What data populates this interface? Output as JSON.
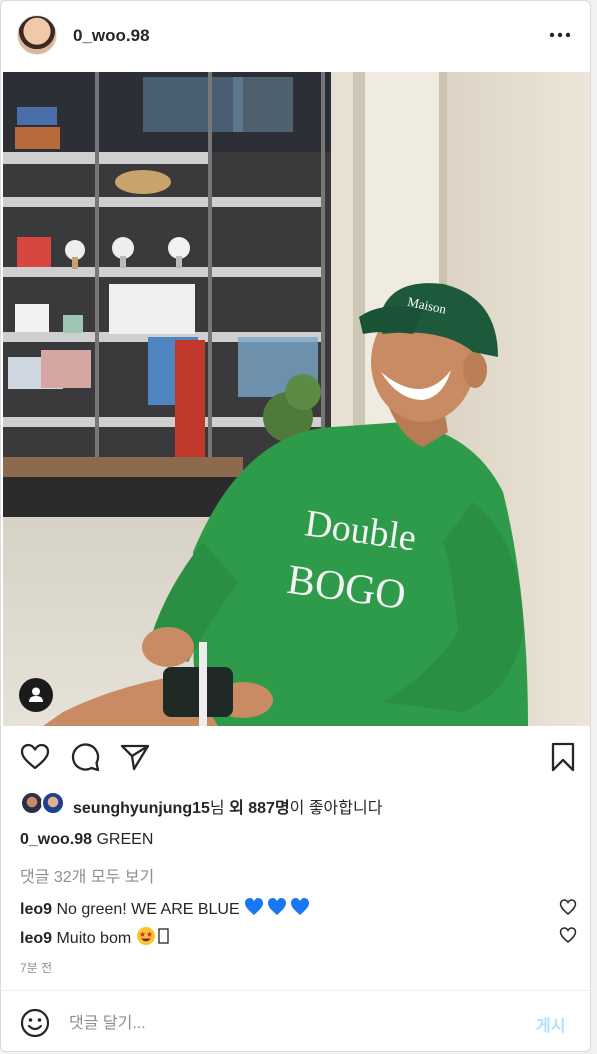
{
  "header": {
    "username": "0_woo.98",
    "more_icon": "more-horizontal-icon"
  },
  "photo": {
    "sweater_text_line1": "Double",
    "sweater_text_line2": "BOGO",
    "cap_text": "Maison",
    "user_tag_icon": "user-tag-icon"
  },
  "actions": {
    "like_icon": "heart-icon",
    "comment_icon": "comment-icon",
    "share_icon": "send-icon",
    "save_icon": "bookmark-icon"
  },
  "likes": {
    "liker": "seunghyunjung15",
    "suffix1": "님 ",
    "others": "외 887명",
    "suffix2": "이 좋아합니다"
  },
  "caption": {
    "username": "0_woo.98",
    "text": "GREEN"
  },
  "view_all_comments": "댓글 32개 모두 보기",
  "comments": [
    {
      "username": "leo9",
      "text": "No green! WE ARE BLUE ",
      "emoji": "blue-heart x3"
    },
    {
      "username": "leo9",
      "text": "Muito bom ",
      "emoji": "star-struck + missing glyph"
    }
  ],
  "timestamp": "7분 전",
  "comment_box": {
    "placeholder": "댓글 달기...",
    "post_label": "게시"
  },
  "colors": {
    "link_blue": "#b2dffc",
    "sweater_green": "#2e9b4a",
    "cap_green": "#1d5a3c",
    "muted": "#8e8e8e"
  }
}
